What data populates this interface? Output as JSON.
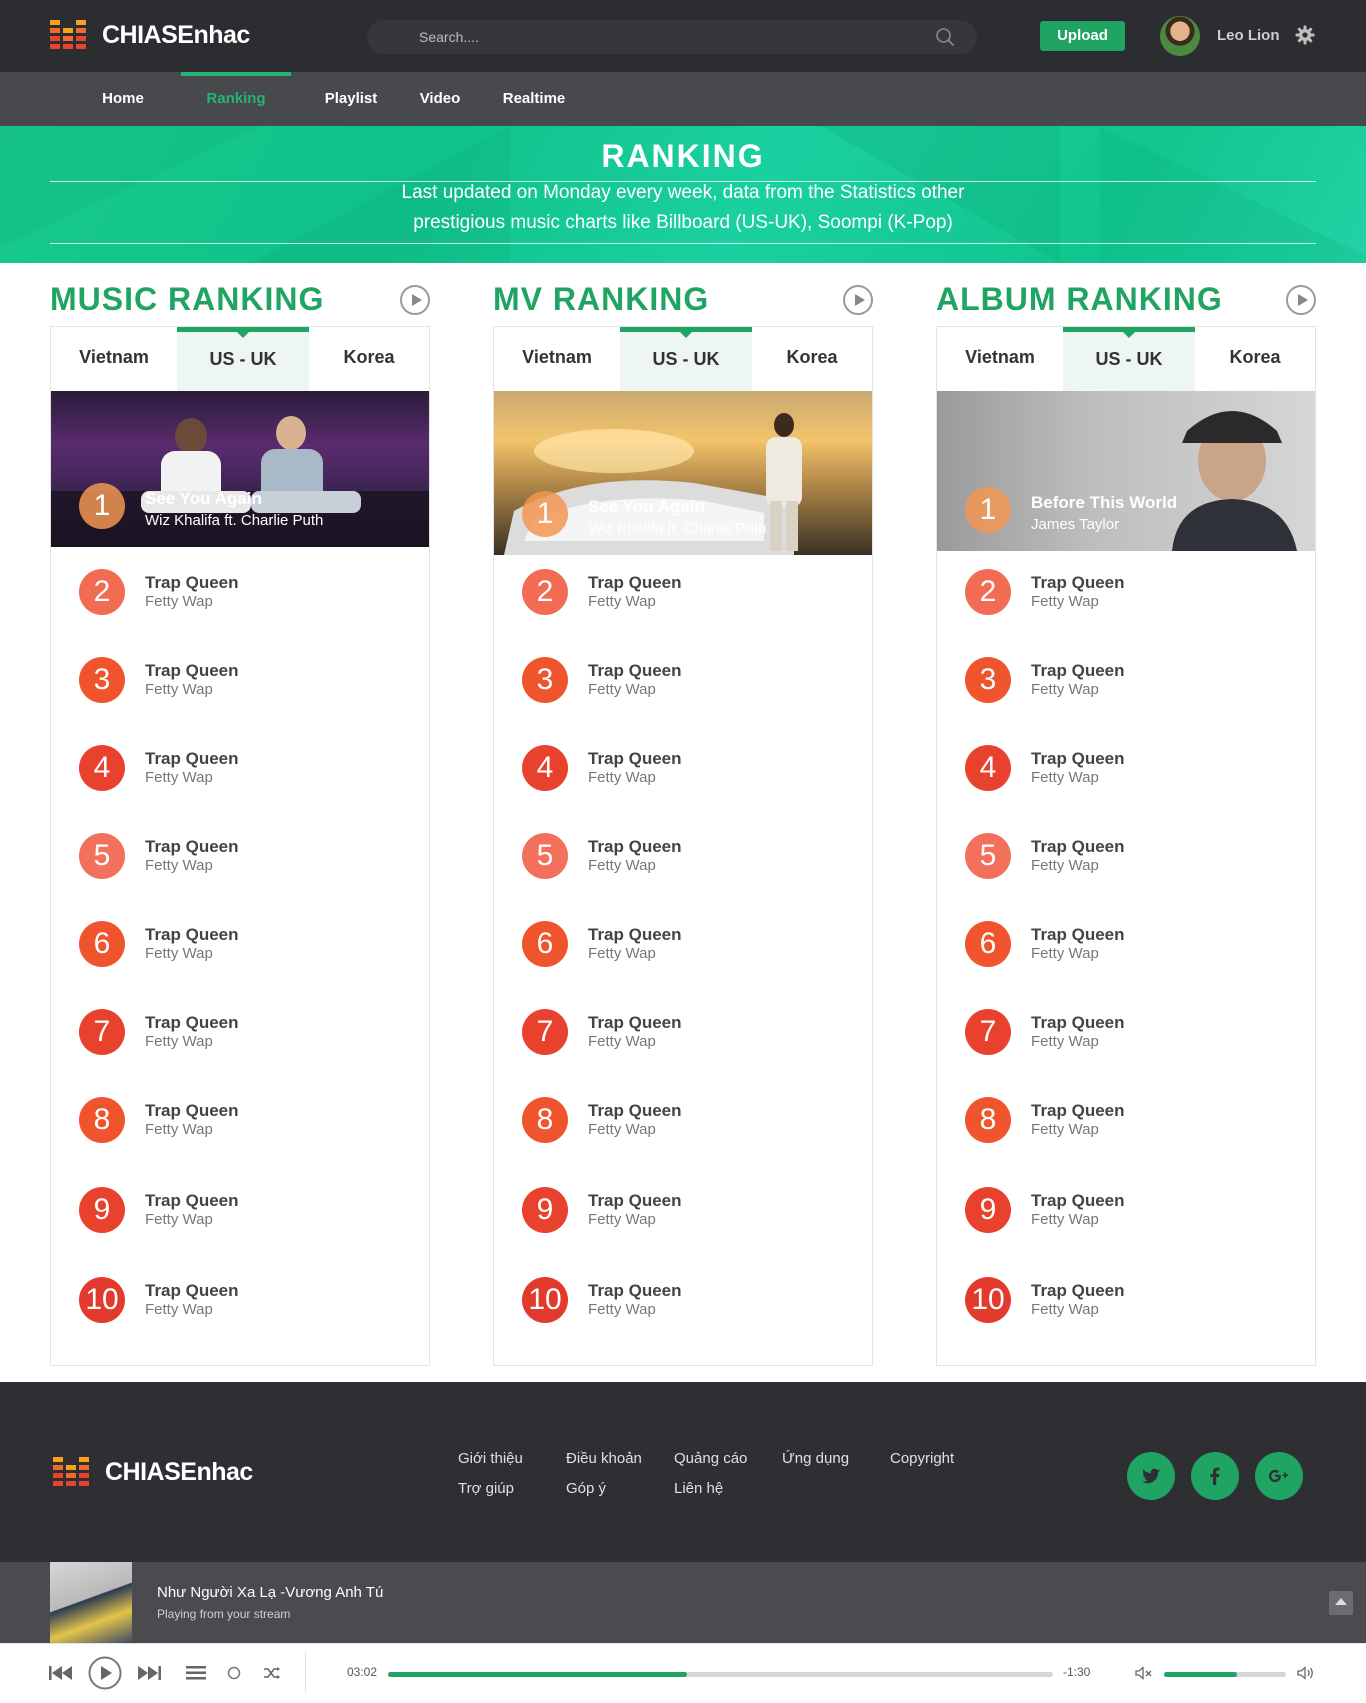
{
  "header": {
    "logo_text": "CHIASEnhac",
    "search_placeholder": "Search....",
    "upload_label": "Upload",
    "user_name": "Leo Lion"
  },
  "nav": [
    "Home",
    "Ranking",
    "Playlist",
    "Video",
    "Realtime"
  ],
  "nav_active": "Ranking",
  "banner": {
    "title": "RANKING",
    "subtitle_line1": "Last updated on Monday every week, data from the Statistics other",
    "subtitle_line2": "prestigious music charts like Billboard (US-UK), Soompi (K-Pop)"
  },
  "sections": [
    {
      "title": "MUSIC RANKING",
      "tabs": [
        "Vietnam",
        "US - UK",
        "Korea"
      ],
      "active_tab": "US - UK",
      "feature": {
        "rank": "1",
        "title": "See You Again",
        "artist": "Wiz Khalifa  ft.  Charlie Puth"
      }
    },
    {
      "title": "MV RANKING",
      "tabs": [
        "Vietnam",
        "US - UK",
        "Korea"
      ],
      "active_tab": "US - UK",
      "feature": {
        "rank": "1",
        "title": "See You Again",
        "artist": "Wiz Khalifa  ft.  Charlie Puth"
      }
    },
    {
      "title": "ALBUM RANKING",
      "tabs": [
        "Vietnam",
        "US - UK",
        "Korea"
      ],
      "active_tab": "US - UK",
      "feature": {
        "rank": "1",
        "title": "Before This World",
        "artist": "James Taylor"
      }
    }
  ],
  "list": [
    {
      "rank": "2",
      "title": "Trap Queen",
      "artist": "Fetty Wap",
      "color": "#f26b53"
    },
    {
      "rank": "3",
      "title": "Trap Queen",
      "artist": "Fetty Wap",
      "color": "#f0542d"
    },
    {
      "rank": "4",
      "title": "Trap Queen",
      "artist": "Fetty Wap",
      "color": "#e8412e"
    },
    {
      "rank": "5",
      "title": "Trap Queen",
      "artist": "Fetty Wap",
      "color": "#f3705c"
    },
    {
      "rank": "6",
      "title": "Trap Queen",
      "artist": "Fetty Wap",
      "color": "#f0542d"
    },
    {
      "rank": "7",
      "title": "Trap Queen",
      "artist": "Fetty Wap",
      "color": "#e8412e"
    },
    {
      "rank": "8",
      "title": "Trap Queen",
      "artist": "Fetty Wap",
      "color": "#f0542d"
    },
    {
      "rank": "9",
      "title": "Trap Queen",
      "artist": "Fetty Wap",
      "color": "#e8412e"
    },
    {
      "rank": "10",
      "title": "Trap Queen",
      "artist": "Fetty Wap",
      "color": "#e23a2c"
    }
  ],
  "footer": {
    "logo_text": "CHIASEnhac",
    "links_row1": [
      "Giới thiệu",
      "Điều khoản",
      "Quảng cáo",
      "Ứng dụng",
      "Copyright"
    ],
    "links_row2": [
      "Trợ giúp",
      "Góp ý",
      "Liên hệ"
    ],
    "social_icons": [
      "twitter-icon",
      "facebook-icon",
      "google-plus-icon"
    ]
  },
  "player": {
    "title": "Như Người Xa Lạ -Vương Anh Tú",
    "subtitle": "Playing from your stream",
    "elapsed": "03:02",
    "remaining": "-1:30",
    "progress": 0.45,
    "volume": 0.6
  },
  "colors": {
    "accent": "#1fa463",
    "header_bg": "#2b2d31",
    "nav_bg": "#48494d",
    "footer_bg": "#2d2f33"
  }
}
